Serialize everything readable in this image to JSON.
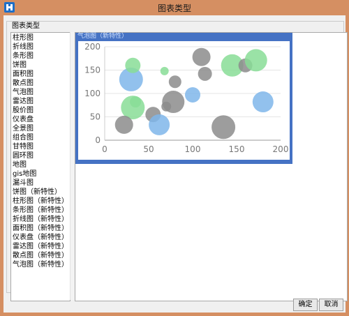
{
  "window": {
    "title": "图表类型"
  },
  "group": {
    "title": "图表类型"
  },
  "list": {
    "selected_index": 27,
    "items": [
      "柱形图",
      "折线图",
      "条形图",
      "饼图",
      "面积图",
      "散点图",
      "气泡图",
      "雷达图",
      "股价图",
      "仪表盘",
      "全景图",
      "组合图",
      "甘特图",
      "圆环图",
      "地图",
      "gis地图",
      "漏斗图",
      "饼图（新特性）",
      "柱形图（新特性）",
      "条形图（新特性）",
      "折线图（新特性）",
      "面积图（新特性）",
      "仪表盘（新特性）",
      "雷达图（新特性）",
      "散点图（新特性）",
      "气泡图（新特性）"
    ]
  },
  "preview": {
    "label": "气泡图（新特性）"
  },
  "chart_data": {
    "type": "scatter",
    "variant": "bubble",
    "xlim": [
      0,
      200
    ],
    "ylim": [
      0,
      200
    ],
    "x_ticks": [
      "0",
      "50",
      "100",
      "150",
      "200"
    ],
    "y_ticks": [
      "0",
      "50",
      "100",
      "150",
      "200"
    ],
    "grid": "horizontal",
    "colors": {
      "blue": "#7fb6ea",
      "green": "#88dd96",
      "gray": "#8c8c8c"
    },
    "bubbles": [
      {
        "x": 30,
        "y": 130,
        "size": 17,
        "color": "blue"
      },
      {
        "x": 32,
        "y": 160,
        "size": 11,
        "color": "green"
      },
      {
        "x": 68,
        "y": 148,
        "size": 6,
        "color": "green"
      },
      {
        "x": 80,
        "y": 125,
        "size": 9,
        "color": "gray"
      },
      {
        "x": 100,
        "y": 97,
        "size": 11,
        "color": "blue"
      },
      {
        "x": 110,
        "y": 178,
        "size": 13,
        "color": "gray"
      },
      {
        "x": 114,
        "y": 142,
        "size": 10,
        "color": "gray"
      },
      {
        "x": 145,
        "y": 160,
        "size": 16,
        "color": "green"
      },
      {
        "x": 160,
        "y": 160,
        "size": 10,
        "color": "gray"
      },
      {
        "x": 172,
        "y": 171,
        "size": 16,
        "color": "green"
      },
      {
        "x": 180,
        "y": 82,
        "size": 15,
        "color": "blue"
      },
      {
        "x": 78,
        "y": 82,
        "size": 16,
        "color": "gray"
      },
      {
        "x": 70,
        "y": 72,
        "size": 7,
        "color": "gray"
      },
      {
        "x": 32,
        "y": 70,
        "size": 17,
        "color": "green"
      },
      {
        "x": 35,
        "y": 82,
        "size": 8,
        "color": "green"
      },
      {
        "x": 55,
        "y": 55,
        "size": 11,
        "color": "gray"
      },
      {
        "x": 62,
        "y": 33,
        "size": 15,
        "color": "blue"
      },
      {
        "x": 22,
        "y": 33,
        "size": 13,
        "color": "gray"
      },
      {
        "x": 135,
        "y": 28,
        "size": 17,
        "color": "gray"
      }
    ]
  },
  "buttons": {
    "ok": "确定",
    "cancel": "取消"
  }
}
